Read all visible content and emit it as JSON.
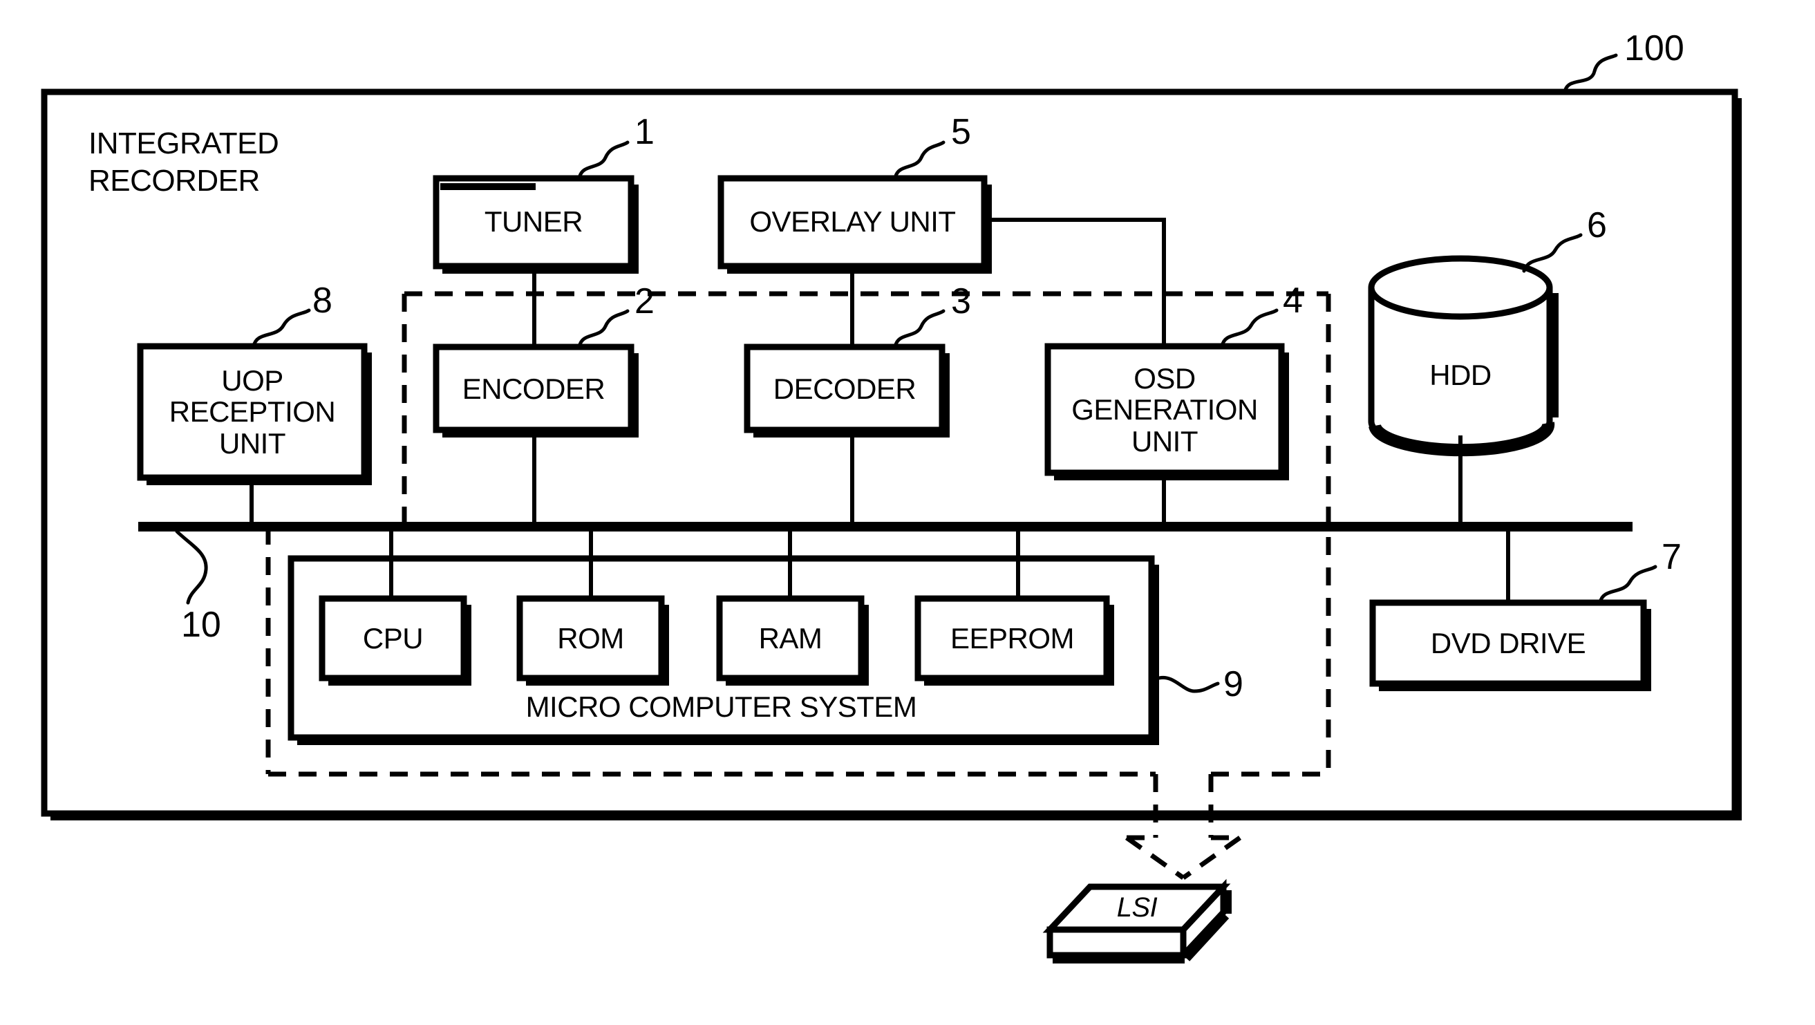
{
  "figure": {
    "outer_label": "INTEGRATED\nRECORDER",
    "outer_ref": "100",
    "bus_ref": "10",
    "chip_label": "LSI"
  },
  "blocks": [
    {
      "id": "tuner",
      "label": "TUNER",
      "ref": "1"
    },
    {
      "id": "overlay",
      "label": "OVERLAY UNIT",
      "ref": "5"
    },
    {
      "id": "uop",
      "label": "UOP\nRECEPTION\nUNIT",
      "ref": "8"
    },
    {
      "id": "encoder",
      "label": "ENCODER",
      "ref": "2"
    },
    {
      "id": "decoder",
      "label": "DECODER",
      "ref": "3"
    },
    {
      "id": "osd",
      "label": "OSD\nGENERATION\nUNIT",
      "ref": "4"
    },
    {
      "id": "hdd",
      "label": "HDD",
      "ref": "6"
    },
    {
      "id": "dvd",
      "label": "DVD DRIVE",
      "ref": "7"
    },
    {
      "id": "micro",
      "label": "MICRO COMPUTER SYSTEM",
      "ref": "9"
    },
    {
      "id": "cpu",
      "label": "CPU",
      "ref": ""
    },
    {
      "id": "rom",
      "label": "ROM",
      "ref": ""
    },
    {
      "id": "ram",
      "label": "RAM",
      "ref": ""
    },
    {
      "id": "eeprom",
      "label": "EEPROM",
      "ref": ""
    }
  ],
  "labels": {
    "tuner": "TUNER",
    "overlay": "OVERLAY UNIT",
    "uop_line1": "UOP",
    "uop_line2": "RECEPTION",
    "uop_line3": "UNIT",
    "encoder": "ENCODER",
    "decoder": "DECODER",
    "osd_line1": "OSD",
    "osd_line2": "GENERATION",
    "osd_line3": "UNIT",
    "hdd": "HDD",
    "dvd": "DVD DRIVE",
    "micro": "MICRO COMPUTER SYSTEM",
    "cpu": "CPU",
    "rom": "ROM",
    "ram": "RAM",
    "eeprom": "EEPROM",
    "lsi": "LSI",
    "integrated_line1": "INTEGRATED",
    "integrated_line2": "RECORDER"
  },
  "refs": {
    "outer": "100",
    "tuner": "1",
    "encoder": "2",
    "decoder": "3",
    "osd": "4",
    "overlay": "5",
    "hdd": "6",
    "dvd": "7",
    "uop": "8",
    "micro": "9",
    "bus": "10"
  },
  "colors": {
    "line": "#000000",
    "background": "#ffffff"
  }
}
